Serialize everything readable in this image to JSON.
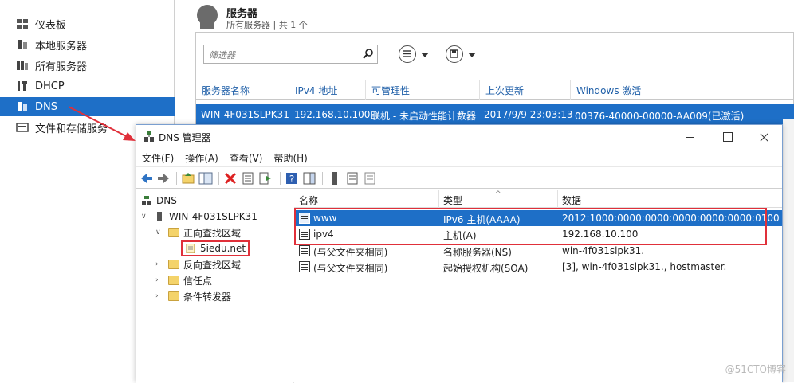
{
  "sidebar": {
    "items": [
      {
        "label": "仪表板",
        "icon": "dashboard-icon"
      },
      {
        "label": "本地服务器",
        "icon": "server-icon"
      },
      {
        "label": "所有服务器",
        "icon": "servers-icon"
      },
      {
        "label": "DHCP",
        "icon": "dhcp-icon"
      },
      {
        "label": "DNS",
        "icon": "dns-icon",
        "active": true
      },
      {
        "label": "文件和存储服务",
        "icon": "storage-icon"
      }
    ]
  },
  "servers_panel": {
    "title": "服务器",
    "subtitle": "所有服务器 | 共 1 个",
    "filter_placeholder": "筛选器",
    "columns": [
      "服务器名称",
      "IPv4 地址",
      "可管理性",
      "上次更新",
      "Windows 激活"
    ],
    "row": {
      "name": "WIN-4F031SLPK31",
      "ipv4": "192.168.10.100",
      "manageability": "联机 - 未启动性能计数器",
      "last_update": "2017/9/9 23:03:13",
      "activation": "00376-40000-00000-AA009(已激活)"
    }
  },
  "dns_window": {
    "title": "DNS 管理器",
    "menu": [
      "文件(F)",
      "操作(A)",
      "查看(V)",
      "帮助(H)"
    ],
    "tree": {
      "root": "DNS",
      "server": "WIN-4F031SLPK31",
      "forward_zones": "正向查找区域",
      "zone": "5iedu.net",
      "reverse_zones": "反向查找区域",
      "trust_points": "信任点",
      "conditional_forwarders": "条件转发器"
    },
    "list": {
      "columns": [
        "名称",
        "类型",
        "数据"
      ],
      "records": [
        {
          "name": "www",
          "type": "IPv6 主机(AAAA)",
          "data": "2012:1000:0000:0000:0000:0000:0000:0100"
        },
        {
          "name": "ipv4",
          "type": "主机(A)",
          "data": "192.168.10.100"
        },
        {
          "name": "(与父文件夹相同)",
          "type": "名称服务器(NS)",
          "data": "win-4f031slpk31."
        },
        {
          "name": "(与父文件夹相同)",
          "type": "起始授权机构(SOA)",
          "data": "[3], win-4f031slpk31., hostmaster."
        }
      ]
    }
  },
  "watermark": "@51CTO博客",
  "colors": {
    "selection": "#1e6fc7",
    "highlight_border": "#e0303a",
    "link": "#1f5fa8"
  }
}
